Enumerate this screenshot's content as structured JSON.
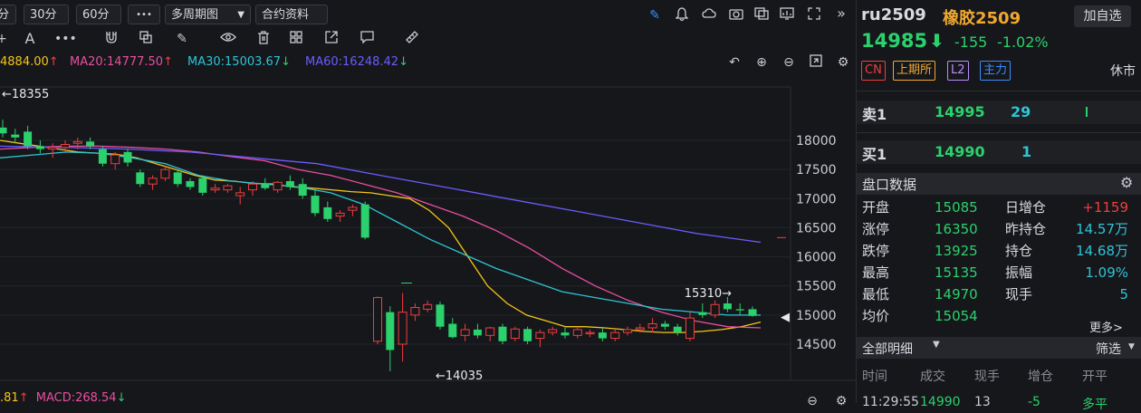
{
  "toolbar": {
    "period_partial": "分",
    "period_30": "30分",
    "period_60": "60分",
    "more_dots": "•••",
    "multi_period": "多周期图",
    "contract_info": "合约资料"
  },
  "ma_legend": {
    "ma10": "4884.00",
    "ma20": "MA20:14777.50",
    "ma30": "MA30:15003.67",
    "ma60": "MA60:16248.42",
    "colors": {
      "ma10": "#f5c518",
      "ma20": "#e84fa0",
      "ma30": "#2ec4d6",
      "ma60": "#6a5cff"
    }
  },
  "macd_legend": {
    "left": ".81",
    "macd": "MACD:268.54"
  },
  "chart_data": {
    "type": "candlestick",
    "y_ticks": [
      "18000",
      "17500",
      "17000",
      "16500",
      "16000",
      "15500",
      "15000",
      "14500"
    ],
    "ylim": [
      14100,
      18500
    ],
    "annotations": {
      "high": "←18355",
      "low": "←14035",
      "recent_high": "15310→"
    },
    "last_price_marker": "◀",
    "candles": [
      {
        "o": 18220,
        "h": 18355,
        "l": 18050,
        "c": 18120
      },
      {
        "o": 18100,
        "h": 18200,
        "l": 17950,
        "c": 18050
      },
      {
        "o": 18150,
        "h": 18250,
        "l": 17850,
        "c": 17900
      },
      {
        "o": 17900,
        "h": 18000,
        "l": 17780,
        "c": 17850
      },
      {
        "o": 17850,
        "h": 17950,
        "l": 17700,
        "c": 17880
      },
      {
        "o": 17880,
        "h": 18000,
        "l": 17800,
        "c": 17930
      },
      {
        "o": 17950,
        "h": 18050,
        "l": 17850,
        "c": 17980
      },
      {
        "o": 17980,
        "h": 18050,
        "l": 17850,
        "c": 17900
      },
      {
        "o": 17850,
        "h": 17900,
        "l": 17550,
        "c": 17600
      },
      {
        "o": 17600,
        "h": 17800,
        "l": 17500,
        "c": 17750
      },
      {
        "o": 17800,
        "h": 17850,
        "l": 17550,
        "c": 17620
      },
      {
        "o": 17450,
        "h": 17500,
        "l": 17200,
        "c": 17250
      },
      {
        "o": 17250,
        "h": 17400,
        "l": 17150,
        "c": 17350
      },
      {
        "o": 17350,
        "h": 17550,
        "l": 17300,
        "c": 17500
      },
      {
        "o": 17450,
        "h": 17500,
        "l": 17200,
        "c": 17250
      },
      {
        "o": 17300,
        "h": 17350,
        "l": 17150,
        "c": 17200
      },
      {
        "o": 17350,
        "h": 17400,
        "l": 17050,
        "c": 17100
      },
      {
        "o": 17150,
        "h": 17250,
        "l": 17100,
        "c": 17180
      },
      {
        "o": 17150,
        "h": 17250,
        "l": 17100,
        "c": 17220
      },
      {
        "o": 17050,
        "h": 17200,
        "l": 16900,
        "c": 17100
      },
      {
        "o": 17150,
        "h": 17300,
        "l": 17050,
        "c": 17250
      },
      {
        "o": 17250,
        "h": 17350,
        "l": 17150,
        "c": 17180
      },
      {
        "o": 17150,
        "h": 17300,
        "l": 17100,
        "c": 17280
      },
      {
        "o": 17300,
        "h": 17400,
        "l": 17150,
        "c": 17200
      },
      {
        "o": 17250,
        "h": 17350,
        "l": 17000,
        "c": 17050
      },
      {
        "o": 17050,
        "h": 17150,
        "l": 16700,
        "c": 16750
      },
      {
        "o": 16850,
        "h": 16950,
        "l": 16600,
        "c": 16650
      },
      {
        "o": 16700,
        "h": 16800,
        "l": 16600,
        "c": 16750
      },
      {
        "o": 16800,
        "h": 16900,
        "l": 16700,
        "c": 16850
      },
      {
        "o": 16900,
        "h": 16950,
        "l": 16300,
        "c": 16330
      },
      {
        "o": 14550,
        "h": 15320,
        "l": 14500,
        "c": 15300
      },
      {
        "o": 15050,
        "h": 15150,
        "l": 14035,
        "c": 14400
      },
      {
        "o": 14500,
        "h": 15380,
        "l": 14200,
        "c": 15050
      },
      {
        "o": 15000,
        "h": 15200,
        "l": 14900,
        "c": 15130
      },
      {
        "o": 15100,
        "h": 15250,
        "l": 15050,
        "c": 15180
      },
      {
        "o": 15180,
        "h": 15230,
        "l": 14750,
        "c": 14800
      },
      {
        "o": 14850,
        "h": 14950,
        "l": 14600,
        "c": 14620
      },
      {
        "o": 14650,
        "h": 14850,
        "l": 14550,
        "c": 14750
      },
      {
        "o": 14750,
        "h": 14850,
        "l": 14600,
        "c": 14650
      },
      {
        "o": 14650,
        "h": 14800,
        "l": 14550,
        "c": 14780
      },
      {
        "o": 14800,
        "h": 14850,
        "l": 14500,
        "c": 14550
      },
      {
        "o": 14600,
        "h": 14800,
        "l": 14550,
        "c": 14760
      },
      {
        "o": 14760,
        "h": 14800,
        "l": 14500,
        "c": 14550
      },
      {
        "o": 14600,
        "h": 14750,
        "l": 14450,
        "c": 14700
      },
      {
        "o": 14700,
        "h": 14800,
        "l": 14650,
        "c": 14750
      },
      {
        "o": 14700,
        "h": 14800,
        "l": 14600,
        "c": 14650
      },
      {
        "o": 14650,
        "h": 14800,
        "l": 14600,
        "c": 14750
      },
      {
        "o": 14680,
        "h": 14750,
        "l": 14620,
        "c": 14700
      },
      {
        "o": 14700,
        "h": 14780,
        "l": 14550,
        "c": 14600
      },
      {
        "o": 14600,
        "h": 14750,
        "l": 14550,
        "c": 14700
      },
      {
        "o": 14700,
        "h": 14800,
        "l": 14650,
        "c": 14750
      },
      {
        "o": 14750,
        "h": 14850,
        "l": 14700,
        "c": 14780
      },
      {
        "o": 14780,
        "h": 14950,
        "l": 14700,
        "c": 14850
      },
      {
        "o": 14850,
        "h": 14900,
        "l": 14750,
        "c": 14800
      },
      {
        "o": 14800,
        "h": 14850,
        "l": 14650,
        "c": 14700
      },
      {
        "o": 14600,
        "h": 15050,
        "l": 14550,
        "c": 14950
      },
      {
        "o": 15050,
        "h": 15200,
        "l": 14950,
        "c": 15000
      },
      {
        "o": 15000,
        "h": 15250,
        "l": 14950,
        "c": 15180
      },
      {
        "o": 15200,
        "h": 15310,
        "l": 15050,
        "c": 15100
      },
      {
        "o": 15100,
        "h": 15200,
        "l": 15000,
        "c": 15080
      },
      {
        "o": 15100,
        "h": 15150,
        "l": 14970,
        "c": 14985
      }
    ],
    "ma": {
      "ma10": [
        18000,
        17950,
        17900,
        17850,
        17800,
        17780,
        17760,
        17700,
        17600,
        17500,
        17400,
        17320,
        17300,
        17260,
        17250,
        17200,
        17180,
        17150,
        17120,
        17100,
        17050,
        17000,
        16800,
        16500,
        16000,
        15500,
        15200,
        15000,
        14900,
        14800,
        14800,
        14780,
        14750,
        14720,
        14700,
        14700,
        14720,
        14750,
        14800,
        14880
      ],
      "ma20": [
        17850,
        17880,
        17900,
        17900,
        17880,
        17850,
        17800,
        17720,
        17650,
        17500,
        17400,
        17250,
        17100,
        16900,
        16700,
        16450,
        16150,
        15800,
        15500,
        15250,
        15050,
        14900,
        14800,
        14780
      ],
      "ma30": [
        17700,
        17750,
        17800,
        17780,
        17700,
        17600,
        17400,
        17300,
        17250,
        17200,
        17100,
        16900,
        16600,
        16300,
        16050,
        15800,
        15600,
        15400,
        15300,
        15200,
        15100,
        15050,
        15000,
        15000
      ],
      "ma60": [
        17900,
        17880,
        17850,
        17800,
        17700,
        17600,
        17400,
        17200,
        17000,
        16800,
        16600,
        16400,
        16250
      ]
    }
  },
  "quote": {
    "code": "ru2509",
    "name": "橡胶2509",
    "add_button": "加自选",
    "price": "14985",
    "change": "-155",
    "change_pct": "-1.02%",
    "tags": {
      "cn": "CN",
      "exchange": "上期所",
      "level": "L2",
      "main": "主力"
    },
    "status": "休市",
    "sell1": {
      "label": "卖1",
      "price": "14995",
      "vol": "29"
    },
    "buy1": {
      "label": "买1",
      "price": "14990",
      "vol": "1"
    },
    "section_title": "盘口数据",
    "rows": [
      {
        "l1": "开盘",
        "v1": "15085",
        "l2": "日增仓",
        "v2": "+1159"
      },
      {
        "l1": "涨停",
        "v1": "16350",
        "l2": "昨持仓",
        "v2": "14.57万"
      },
      {
        "l1": "跌停",
        "v1": "13925",
        "l2": "持仓",
        "v2": "14.68万"
      },
      {
        "l1": "最高",
        "v1": "15135",
        "l2": "振幅",
        "v2": "1.09%"
      },
      {
        "l1": "最低",
        "v1": "14970",
        "l2": "现手",
        "v2": "5"
      },
      {
        "l1": "均价",
        "v1": "15054",
        "l2": "",
        "v2": ""
      }
    ],
    "more": "更多>",
    "detail_title": "全部明细",
    "filter": "筛选",
    "detail_headers": [
      "时间",
      "成交",
      "现手",
      "增仓",
      "开平"
    ],
    "detail_partial": {
      "time": "11:29:55",
      "price": "14990",
      "vol": "13",
      "chg": "-5",
      "type": "多平"
    }
  }
}
